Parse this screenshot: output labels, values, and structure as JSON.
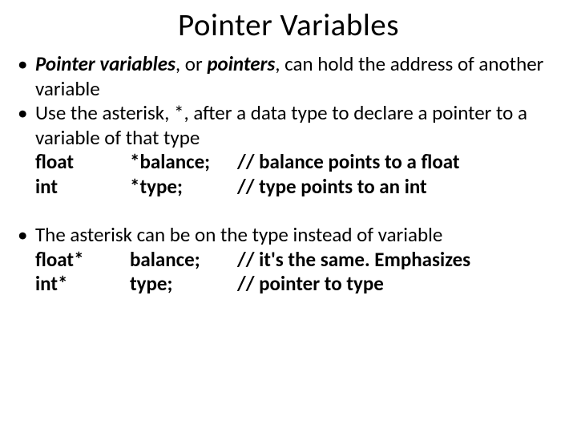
{
  "title": "Pointer Variables",
  "b1": {
    "t1": "Pointer variables",
    "t2": ", or ",
    "t3": "pointers",
    "t4": ", can hold the address of another variable"
  },
  "b2": "Use the asterisk, *, after a data type to declare a pointer to a variable of that type",
  "code1": {
    "r1": {
      "type": "float",
      "var": "*balance;",
      "cmt": "// balance points to a float"
    },
    "r2": {
      "type": "int",
      "var": "*type;",
      "cmt": "// type points to an int"
    }
  },
  "b3": "The asterisk can be on the type instead of variable",
  "code2": {
    "r1": {
      "type": "float*",
      "var": "balance;",
      "cmt": "// it's the same. Emphasizes"
    },
    "r2": {
      "type": "int*",
      "var": "type;",
      "cmt": "// pointer to type"
    }
  }
}
